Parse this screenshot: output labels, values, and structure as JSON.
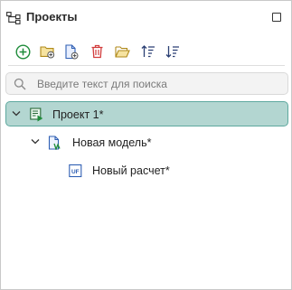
{
  "panel": {
    "title": "Проекты",
    "icons": {
      "panel": "project-tree-icon",
      "maximize": "maximize-icon"
    }
  },
  "toolbar": {
    "buttons": [
      {
        "name": "add-button",
        "icon": "plus-circle-icon"
      },
      {
        "name": "new-folder-button",
        "icon": "folder-add-icon"
      },
      {
        "name": "new-file-button",
        "icon": "file-add-icon"
      },
      {
        "name": "delete-button",
        "icon": "trash-icon"
      },
      {
        "name": "open-folder-button",
        "icon": "folder-open-icon"
      },
      {
        "name": "sort-ascending-button",
        "icon": "sort-ascending-icon"
      },
      {
        "name": "sort-descending-button",
        "icon": "sort-descending-icon"
      }
    ]
  },
  "search": {
    "placeholder": "Введите текст для поиска",
    "value": ""
  },
  "tree": {
    "project": {
      "label": "Проект 1*",
      "expanded": true,
      "selected": true
    },
    "model": {
      "label": "Новая модель*",
      "expanded": true
    },
    "calc": {
      "label": "Новый расчет*",
      "badge": "UF"
    }
  },
  "colors": {
    "accent_green": "#1e8c3a",
    "folder_yellow": "#c9a227",
    "file_blue": "#2f5fb3",
    "delete_red": "#d23c3c",
    "selection_bg": "#b3d6d1",
    "selection_border": "#5ea99f"
  }
}
